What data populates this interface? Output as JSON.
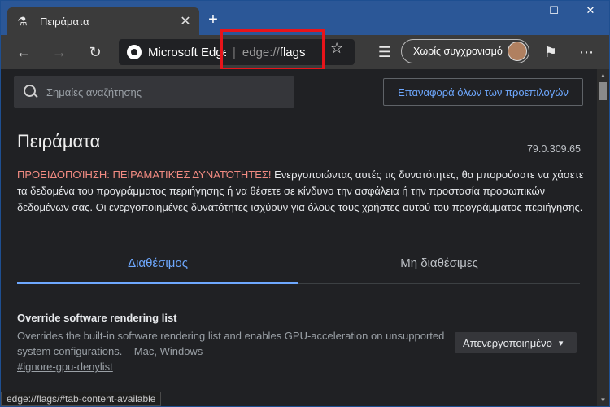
{
  "tab": {
    "title": "Πειράματα",
    "icon": "flask-icon"
  },
  "toolbar": {
    "site_name": "Microsoft Edge",
    "url_scheme": "edge://",
    "url_path": "flags",
    "sync_label": "Χωρίς συγχρονισμό"
  },
  "search": {
    "placeholder": "Σημαίες αναζήτησης"
  },
  "reset_label": "Επαναφορά όλων των προεπιλογών",
  "page": {
    "title": "Πειράματα",
    "version": "79.0.309.65",
    "warning_label": "ΠΡΟΕΙΔΟΠΟΊΗΣΗ: ΠΕΙΡΑΜΑΤΙΚΈΣ ΔΥΝΑΤΌΤΗΤΕΣ!",
    "warning_text": " Ενεργοποιώντας αυτές τις δυνατότητες, θα μπορούσατε να χάσετε τα δεδομένα του προγράμματος περιήγησης ή να θέσετε σε κίνδυνο την ασφάλεια ή την προστασία προσωπικών δεδομένων σας. Οι ενεργοποιημένες δυνατότητες ισχύουν για όλους τους χρήστες αυτού του προγράμματος περιήγησης."
  },
  "tabs": {
    "available": "Διαθέσιμος",
    "unavailable": "Μη διαθέσιμες"
  },
  "flag": {
    "title": "Override software rendering list",
    "description": "Overrides the built-in software rendering list and enables GPU-acceleration on unsupported system configurations. – Mac, Windows",
    "link": "#ignore-gpu-denylist",
    "selected": "Απενεργοποιημένο"
  },
  "status_url": "edge://flags/#tab-content-available",
  "colors": {
    "accent": "#6ea8fe",
    "warning": "#f28b82",
    "highlight": "#e8141a"
  }
}
